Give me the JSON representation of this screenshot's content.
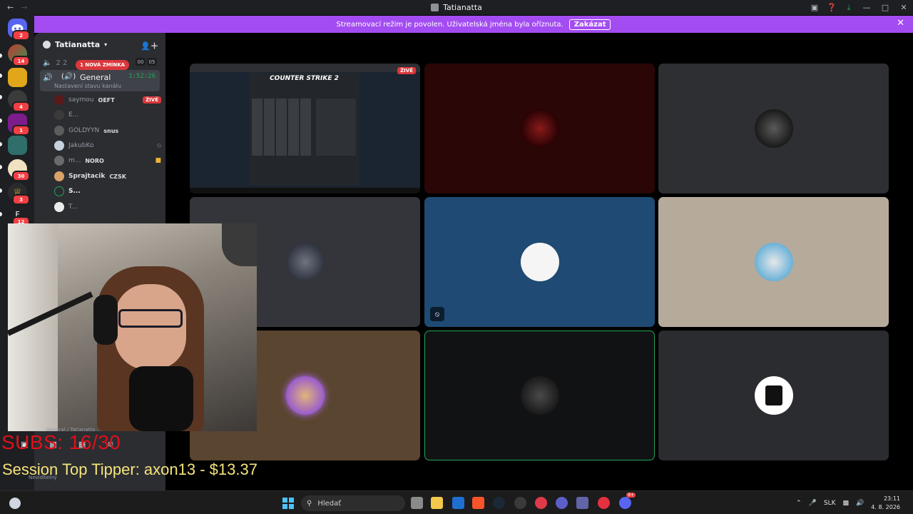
{
  "window": {
    "title": "Tatianatta"
  },
  "banner": {
    "text": "Streamovací režim je povolen. Uživatelská jména byla oříznuta.",
    "button": "Zakázat"
  },
  "rail": {
    "badges": [
      "2",
      "14",
      "",
      "4",
      "1",
      "",
      "30",
      "3",
      "12"
    ]
  },
  "sidebar": {
    "guild_name": "Tatianatta",
    "top_channel": {
      "label": "2 2",
      "counts": [
        "00",
        "05"
      ]
    },
    "mention_pill": "1 NOVÁ ZMÍNKA",
    "active_channel": {
      "name": "General",
      "status": "Nastavení stavu kanálu",
      "timer": "1:52:26"
    },
    "voice_users": [
      {
        "name": "saymou",
        "tag": "OEFT",
        "live": "ŽIVĚ"
      },
      {
        "name": "E...",
        "tag": ""
      },
      {
        "name": "GOLDYYN",
        "tag": "snus"
      },
      {
        "name": "JakubKo",
        "tag": ""
      },
      {
        "name": "m...",
        "tag": "NORO"
      },
      {
        "name": "Sprajtacik",
        "tag": "CZSK"
      },
      {
        "name": "S...",
        "tag": ""
      },
      {
        "name": "T...",
        "tag": ""
      }
    ]
  },
  "main": {
    "stream_live": "ŽIVĚ",
    "stream_title": "COUNTER STRIKE 2"
  },
  "overlay": {
    "subs": "SUBS: 16/30",
    "tipper": "Session Top Tipper: axon13 - $13.37",
    "voice_footer": "General / Tatianatta",
    "user_status": "Neviditelný"
  },
  "taskbar": {
    "search_placeholder": "Hledať",
    "lang": "SLK",
    "time": "23:11",
    "date": "4. 8. 2026",
    "discord_badge": "9+"
  },
  "colors": {
    "accent": "#a34cf1",
    "live": "#da373c",
    "speaking": "#23a55a"
  }
}
